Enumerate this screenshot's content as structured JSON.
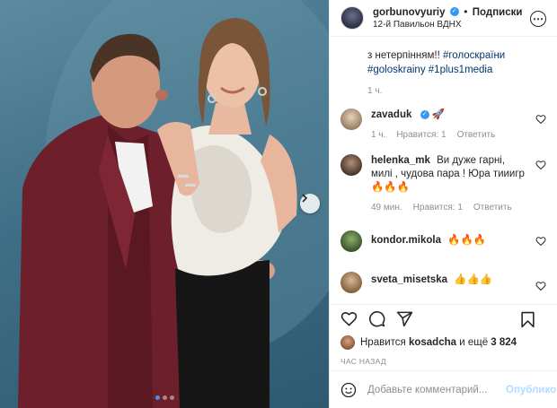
{
  "header": {
    "username": "gorbunovyuriy",
    "separator": "•",
    "follow_label": "Подписки",
    "location": "12-й Павильон ВДНХ"
  },
  "caption": {
    "line1": "з нетерпінням!! ",
    "tag1": "#голоскраїни",
    "tag2": "#goloskrainy",
    "tag3": "#1plus1media",
    "time": "1 ч."
  },
  "comments": [
    {
      "username": "zavaduk",
      "text": "🚀",
      "time": "1 ч.",
      "likes": "Нравится: 1",
      "reply": "Ответить",
      "avatar_color": "#c9b59a"
    },
    {
      "username": "helenka_mk",
      "text": "Ви дуже гарні, милі , чудова пара ! Юра тииигр🔥🔥🔥",
      "time": "49 мин.",
      "likes": "Нравится: 1",
      "reply": "Ответить",
      "avatar_color": "#5a4538"
    },
    {
      "username": "kondor.mikola",
      "text": "🔥🔥🔥",
      "time": "",
      "likes": "",
      "reply": "",
      "avatar_color": "#4d6b3a"
    },
    {
      "username": "sveta_misetska",
      "text": "👍👍👍",
      "time": "",
      "likes": "",
      "reply": "",
      "avatar_color": "#a47d55"
    }
  ],
  "likes": {
    "prefix": "Нравится",
    "user": "kosadcha",
    "middle": "и ещё",
    "count": "3 824"
  },
  "timestamp": "ЧАС НАЗАД",
  "add_comment": {
    "placeholder": "Добавьте комментарий...",
    "publish_label": "Опубликовать"
  },
  "colors": {
    "accent": "#3897f0",
    "hashtag": "#00376b",
    "muted": "#8e8e8e",
    "publish_disabled": "#b3dbff"
  },
  "carousel": {
    "slides": 3,
    "active": 1
  },
  "icons": [
    "heart-icon",
    "comment-icon",
    "share-icon",
    "bookmark-icon",
    "emoji-icon",
    "more-icon",
    "chevron-right-icon",
    "verified-icon"
  ]
}
